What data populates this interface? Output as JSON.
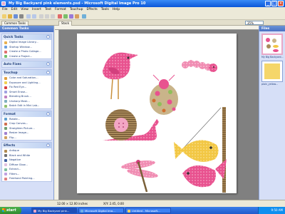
{
  "window": {
    "title": "My Big Backyard pink elements.psd - Microsoft Digital Image Pro 10",
    "min": "_",
    "max": "□",
    "close": "×"
  },
  "menu": [
    "File",
    "Edit",
    "View",
    "Insert",
    "Text",
    "Format",
    "Touchup",
    "Effects",
    "Tools",
    "Help"
  ],
  "tabs": {
    "common": "Common Tasks",
    "stack": "Stack"
  },
  "zoom": "35%",
  "left_panel": {
    "header": "Common Tasks",
    "sections": [
      {
        "title": "Quick Tasks",
        "items": [
          "Digital Image Library...",
          "Startup Window...",
          "Create a Photo Collage...",
          "Create a Project..."
        ]
      },
      {
        "title": "Auto Fixes",
        "items": []
      },
      {
        "title": "Touchup",
        "items": [
          "Color and Saturation...",
          "Exposure and Lighting...",
          "Fix Red Eye...",
          "Smart Erase...",
          "Blending Brush...",
          "Unsharp Mask...",
          "Batch Edit in Mini Lab..."
        ]
      },
      {
        "title": "Format",
        "items": [
          "Rotate...",
          "Crop Canvas...",
          "Straighten Picture...",
          "Resize Image...",
          "Flip..."
        ]
      },
      {
        "title": "Effects",
        "items": [
          "Antique",
          "Black and White",
          "Negative",
          "Diffuse Glow...",
          "Extract...",
          "Filters...",
          "Freehand Painting..."
        ]
      }
    ]
  },
  "right_panel": {
    "header": "Files",
    "files": [
      "My Big Backyard...",
      "plain_yellow..."
    ]
  },
  "statusbar": {
    "size": "12.00 × 12.00 inches",
    "coords": "X/Y: 2.45, 0.00"
  },
  "taskbar": {
    "start": "start",
    "buttons": [
      "My Big Backyard pink...",
      "Microsoft Digital Ima...",
      "Untitled - Microsoft..."
    ],
    "time": "9:50 AM"
  },
  "colors": {
    "pink": "#e8528f",
    "light_pink": "#f3a6c4",
    "yellow": "#f2c744",
    "brown": "#8c6a3c"
  }
}
